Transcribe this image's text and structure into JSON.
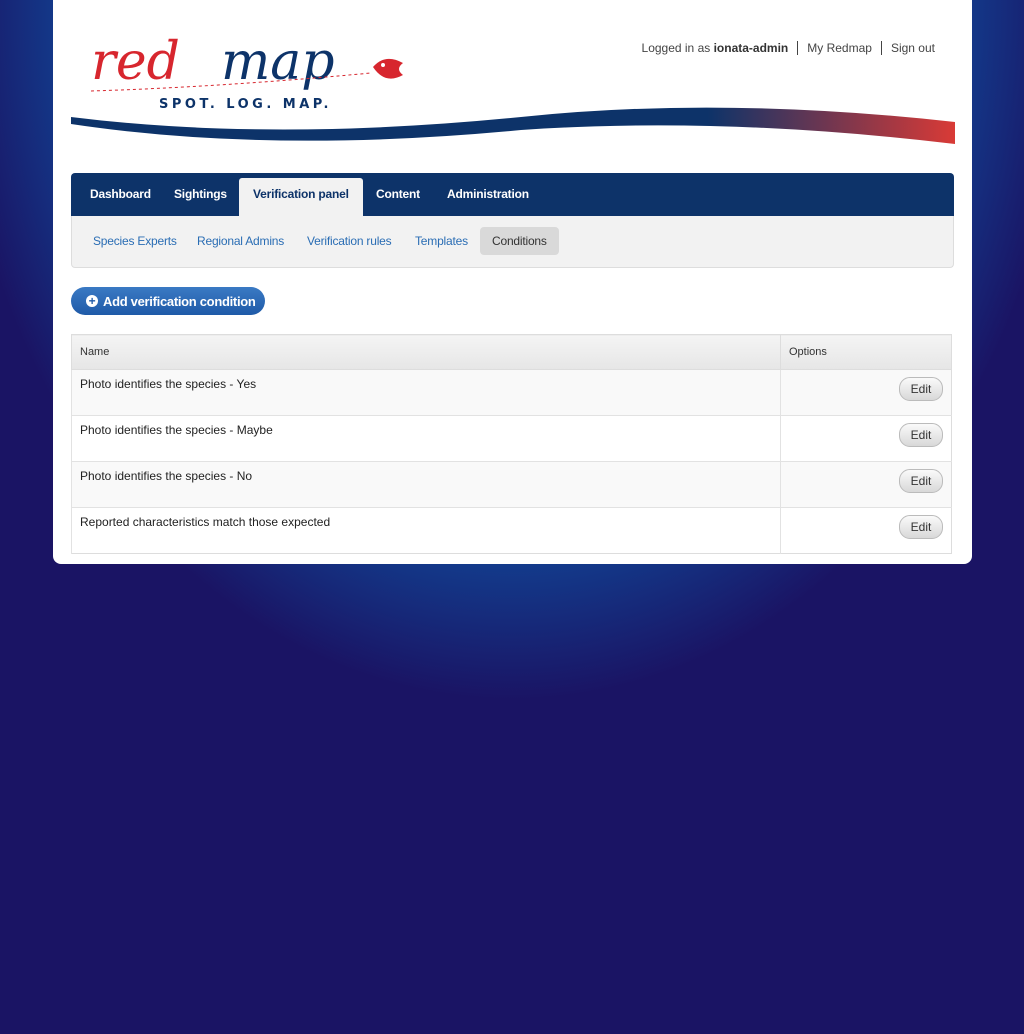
{
  "brand": {
    "wordmark": "redmap",
    "tagline": "SPOT. LOG. MAP."
  },
  "user": {
    "logged_in_prefix": "Logged in as",
    "username": "ionata-admin",
    "my_redmap": "My Redmap",
    "sign_out": "Sign out"
  },
  "mainnav": {
    "tabs": [
      {
        "label": "Dashboard"
      },
      {
        "label": "Sightings"
      },
      {
        "label": "Verification panel",
        "active": true
      },
      {
        "label": "Content"
      },
      {
        "label": "Administration"
      }
    ]
  },
  "subnav": {
    "items": [
      {
        "label": "Species Experts"
      },
      {
        "label": "Regional Admins"
      },
      {
        "label": "Verification rules"
      },
      {
        "label": "Templates"
      },
      {
        "label": "Conditions",
        "active": true
      }
    ]
  },
  "actions": {
    "add_label": "Add verification condition"
  },
  "table": {
    "headers": {
      "name": "Name",
      "options": "Options"
    },
    "rows": [
      {
        "name": "Photo identifies the species - Yes",
        "action": "Edit"
      },
      {
        "name": "Photo identifies the species - Maybe",
        "action": "Edit"
      },
      {
        "name": "Photo identifies the species - No",
        "action": "Edit"
      },
      {
        "name": "Reported characteristics match those expected",
        "action": "Edit"
      }
    ]
  },
  "colors": {
    "nav_bg": "#0d3369",
    "brand_red": "#d7262e",
    "brand_blue": "#0d3369",
    "link_blue": "#2a6db4"
  }
}
